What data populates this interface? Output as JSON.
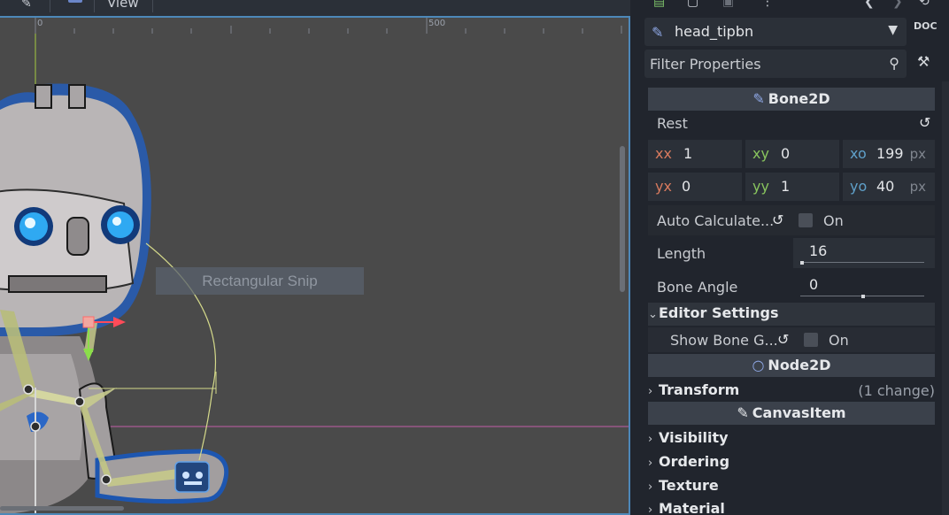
{
  "viewport": {
    "view_menu": "View",
    "ruler_labels": [
      "0",
      "500"
    ],
    "snip_overlay": "Rectangular Snip"
  },
  "inspector": {
    "node_name": "head_tipbn",
    "doc_icon_text": "DOC",
    "filter_placeholder": "Filter Properties",
    "bone2d": {
      "header": "Bone2D",
      "rest_label": "Rest",
      "matrix": [
        {
          "tag": "xx",
          "value": "1",
          "unit": ""
        },
        {
          "tag": "xy",
          "value": "0",
          "unit": ""
        },
        {
          "tag": "xo",
          "value": "199",
          "unit": "px"
        },
        {
          "tag": "yx",
          "value": "0",
          "unit": ""
        },
        {
          "tag": "yy",
          "value": "1",
          "unit": ""
        },
        {
          "tag": "yo",
          "value": "40",
          "unit": "px"
        }
      ],
      "auto_calculate_label": "Auto Calculate...",
      "auto_calculate_checked": false,
      "on_label": "On",
      "length_label": "Length",
      "length_value": "16",
      "bone_angle_label": "Bone Angle",
      "bone_angle_value": "0",
      "editor_settings_label": "Editor Settings",
      "show_bone_label": "Show Bone G...",
      "show_bone_checked": false
    },
    "node2d": {
      "header": "Node2D",
      "transform_label": "Transform",
      "transform_changes": "(1 change)"
    },
    "canvas_item": {
      "header": "CanvasItem",
      "groups": [
        "Visibility",
        "Ordering",
        "Texture",
        "Material"
      ]
    }
  },
  "colors": {
    "viewport_bg": "#4a4a4a",
    "panel_bg": "#21252d",
    "field_bg": "#2b3038",
    "section_header": "#3b414b",
    "accent_blue": "#4d88b9",
    "axis_red": "#d77a5e",
    "axis_green": "#88c45e",
    "axis_blue": "#5fa0c9"
  }
}
